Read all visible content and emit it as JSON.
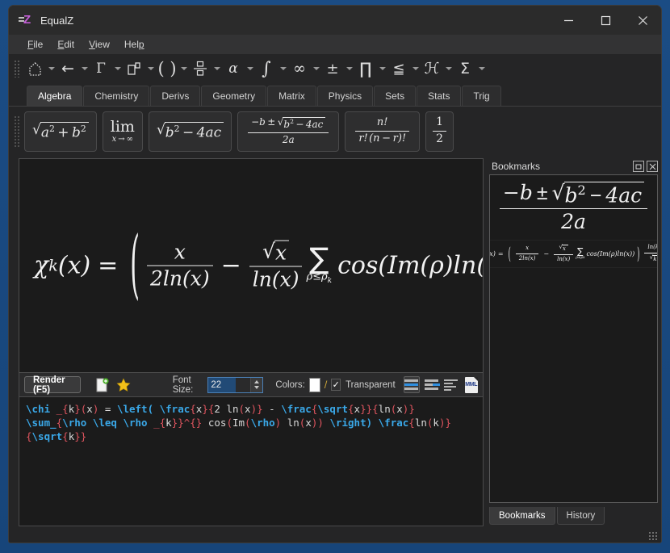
{
  "window": {
    "title": "EqualZ",
    "logo_icon": "equalz-logo-icon",
    "minimize_label": "–",
    "maximize_label": "□",
    "close_label": "✕"
  },
  "menubar": {
    "items": [
      {
        "label": "File",
        "accel": "F"
      },
      {
        "label": "Edit",
        "accel": "E"
      },
      {
        "label": "View",
        "accel": "V"
      },
      {
        "label": "Help",
        "accel": "p"
      }
    ]
  },
  "toolbar": {
    "grip_icon": "drag-grip-icon",
    "items": [
      {
        "glyph": "⌂",
        "name": "template-box-icon",
        "has_dropdown": true
      },
      {
        "glyph": "←",
        "name": "arrow-left-icon",
        "has_dropdown": true
      },
      {
        "glyph": "Γ",
        "name": "gamma-icon",
        "has_dropdown": true
      },
      {
        "glyph": "□▫",
        "name": "superscript-icon",
        "has_dropdown": true
      },
      {
        "glyph": "( )",
        "name": "parentheses-icon",
        "has_dropdown": true
      },
      {
        "glyph": "÷",
        "name": "fraction-icon",
        "has_dropdown": true
      },
      {
        "glyph": "α",
        "name": "alpha-icon",
        "has_dropdown": true
      },
      {
        "glyph": "∫",
        "name": "integral-icon",
        "has_dropdown": true
      },
      {
        "glyph": "∞",
        "name": "infinity-icon",
        "has_dropdown": true
      },
      {
        "glyph": "±",
        "name": "plus-minus-icon",
        "has_dropdown": true
      },
      {
        "glyph": "∏",
        "name": "product-icon",
        "has_dropdown": true
      },
      {
        "glyph": "≤",
        "name": "less-or-equal-icon",
        "has_dropdown": true
      },
      {
        "glyph": "ℋ",
        "name": "script-h-icon",
        "has_dropdown": true
      },
      {
        "glyph": "Σ",
        "name": "sum-icon",
        "has_dropdown": true
      }
    ]
  },
  "category_tabs": {
    "active": "Algebra",
    "items": [
      "Algebra",
      "Chemistry",
      "Derivs",
      "Geometry",
      "Matrix",
      "Physics",
      "Sets",
      "Stats",
      "Trig"
    ]
  },
  "palette": {
    "grip_icon": "palette-grip-icon",
    "items": [
      {
        "name": "palette-sqrt-a2b2",
        "latex": "\\sqrt{a^2+b^2}"
      },
      {
        "name": "palette-limit",
        "latex": "\\lim_{x \\to \\infty}"
      },
      {
        "name": "palette-sqrt-discriminant",
        "latex": "\\sqrt{b^2-4ac}"
      },
      {
        "name": "palette-quadratic-formula",
        "latex": "\\frac{-b \\pm \\sqrt{b^2-4ac}}{2a}"
      },
      {
        "name": "palette-combinations",
        "latex": "\\frac{n!}{r!\\,(n-r)!}"
      },
      {
        "name": "palette-one-half",
        "latex": "\\frac{1}{2}"
      }
    ]
  },
  "render_area": {
    "name": "formula-preview-canvas",
    "formula_description": "chi_k(x) = ( x/(2ln(x)) - sqrt(x)/ln(x) * sum_{rho <= rho_k} cos(Im(rho)ln(x)) ) ln(k)/sqrt(k)",
    "parts": {
      "lhs_chi": "χ",
      "lhs_sub": "k",
      "lhs_arg": "(x)",
      "equals": "=",
      "frac1_num": "x",
      "frac1_den": "2ln(x)",
      "minus": "−",
      "frac2_num_radicand": "x",
      "frac2_den": "ln(x)",
      "sum_glyph": "∑",
      "sum_sub": "ρ≤ρ",
      "sum_sub_sub": "k",
      "cos_expr": "cos(Im(ρ)ln(x))",
      "frac3_num": "ln(k)",
      "frac3_den_radicand": "k",
      "radical": "√"
    }
  },
  "option_bar": {
    "render_button": "Render (F5)",
    "new_doc_icon": "new-document-icon",
    "favorite_icon": "star-favorite-icon",
    "font_size_label": "Font Size:",
    "font_size_value": "22",
    "colors_label": "Colors:",
    "foreground_color": "#ffffff",
    "separator": "/",
    "transparent_checked": true,
    "transparent_check_glyph": "✓",
    "transparent_label": "Transparent",
    "align_buttons": [
      {
        "name": "align-center-button",
        "active": true
      },
      {
        "name": "align-baseline-button",
        "active": false
      },
      {
        "name": "align-left-button",
        "active": false
      }
    ],
    "mathml_button_label": "MML",
    "accent_color": "#2f8fe0"
  },
  "editor": {
    "name": "latex-source-editor",
    "raw": "\\chi _{k}(x) = \\left( \\frac{x}{2 ln(x)} - \\frac{\\sqrt{x}}{ln(x)} \\sum_{\\rho \\leq \\rho _{k}}^{} cos(Im(\\rho) ln(x)) \\right) \\frac{ln(k)}{\\sqrt{k}}",
    "lines": [
      [
        {
          "t": "\\chi",
          "c": "cmd"
        },
        {
          "t": " ",
          "c": "plain"
        },
        {
          "t": "_{",
          "c": "brace"
        },
        {
          "t": "k",
          "c": "plain"
        },
        {
          "t": "}",
          "c": "brace"
        },
        {
          "t": "(",
          "c": "paren"
        },
        {
          "t": "x",
          "c": "plain"
        },
        {
          "t": ")",
          "c": "paren"
        },
        {
          "t": " = ",
          "c": "plain"
        },
        {
          "t": "\\left(",
          "c": "cmd"
        },
        {
          "t": " ",
          "c": "plain"
        },
        {
          "t": "\\frac",
          "c": "cmd"
        },
        {
          "t": "{",
          "c": "brace"
        },
        {
          "t": "x",
          "c": "plain"
        },
        {
          "t": "}",
          "c": "brace"
        },
        {
          "t": "{",
          "c": "brace"
        },
        {
          "t": "2 ln",
          "c": "plain"
        },
        {
          "t": "(",
          "c": "paren"
        },
        {
          "t": "x",
          "c": "plain"
        },
        {
          "t": ")",
          "c": "paren"
        },
        {
          "t": "}",
          "c": "brace"
        },
        {
          "t": " - ",
          "c": "plain"
        },
        {
          "t": "\\frac",
          "c": "cmd"
        },
        {
          "t": "{",
          "c": "brace"
        },
        {
          "t": "\\sqrt",
          "c": "cmd"
        },
        {
          "t": "{",
          "c": "brace"
        },
        {
          "t": "x",
          "c": "plain"
        },
        {
          "t": "}}",
          "c": "brace"
        },
        {
          "t": "{",
          "c": "brace"
        },
        {
          "t": "ln",
          "c": "plain"
        },
        {
          "t": "(",
          "c": "paren"
        },
        {
          "t": "x",
          "c": "plain"
        },
        {
          "t": ")",
          "c": "paren"
        },
        {
          "t": "}",
          "c": "brace"
        }
      ],
      [
        {
          "t": "\\sum_",
          "c": "cmd"
        },
        {
          "t": "{",
          "c": "brace"
        },
        {
          "t": "\\rho",
          "c": "cmd"
        },
        {
          "t": " ",
          "c": "plain"
        },
        {
          "t": "\\leq",
          "c": "cmd"
        },
        {
          "t": " ",
          "c": "plain"
        },
        {
          "t": "\\rho",
          "c": "cmd"
        },
        {
          "t": " ",
          "c": "plain"
        },
        {
          "t": "_{",
          "c": "brace"
        },
        {
          "t": "k",
          "c": "plain"
        },
        {
          "t": "}}",
          "c": "brace"
        },
        {
          "t": "^{}",
          "c": "brace"
        },
        {
          "t": " cos",
          "c": "plain"
        },
        {
          "t": "(",
          "c": "paren"
        },
        {
          "t": "Im",
          "c": "plain"
        },
        {
          "t": "(",
          "c": "paren"
        },
        {
          "t": "\\rho",
          "c": "cmd"
        },
        {
          "t": ")",
          "c": "paren"
        },
        {
          "t": " ln",
          "c": "plain"
        },
        {
          "t": "(",
          "c": "paren"
        },
        {
          "t": "x",
          "c": "plain"
        },
        {
          "t": "))",
          "c": "paren"
        },
        {
          "t": " ",
          "c": "plain"
        },
        {
          "t": "\\right)",
          "c": "cmd"
        },
        {
          "t": " ",
          "c": "plain"
        },
        {
          "t": "\\frac",
          "c": "cmd"
        },
        {
          "t": "{",
          "c": "brace"
        },
        {
          "t": "ln",
          "c": "plain"
        },
        {
          "t": "(",
          "c": "paren"
        },
        {
          "t": "k",
          "c": "plain"
        },
        {
          "t": ")",
          "c": "paren"
        },
        {
          "t": "}",
          "c": "brace"
        }
      ],
      [
        {
          "t": "{",
          "c": "brace"
        },
        {
          "t": "\\sqrt",
          "c": "cmd"
        },
        {
          "t": "{",
          "c": "brace"
        },
        {
          "t": "k",
          "c": "plain"
        },
        {
          "t": "}}",
          "c": "brace"
        }
      ]
    ],
    "colors": {
      "command": "#3aa8e8",
      "brace": "#e0555f",
      "paren": "#e0555f",
      "plain": "#d9d9d9",
      "background": "#1b1b1b"
    }
  },
  "right_dock": {
    "title": "Bookmarks",
    "float_icon": "float-panel-icon",
    "close_icon": "close-panel-icon",
    "bookmarks": [
      {
        "name": "bookmark-quadratic-formula",
        "latex": "\\frac{-b \\pm \\sqrt{b^2-4ac}}{2a}"
      },
      {
        "name": "bookmark-chi-k-formula",
        "latex": "\\chi_k(x) = ..."
      }
    ],
    "tabs": {
      "active": "Bookmarks",
      "items": [
        "Bookmarks",
        "History"
      ]
    }
  },
  "statusbar": {
    "resize_grip_icon": "resize-grip-icon"
  }
}
